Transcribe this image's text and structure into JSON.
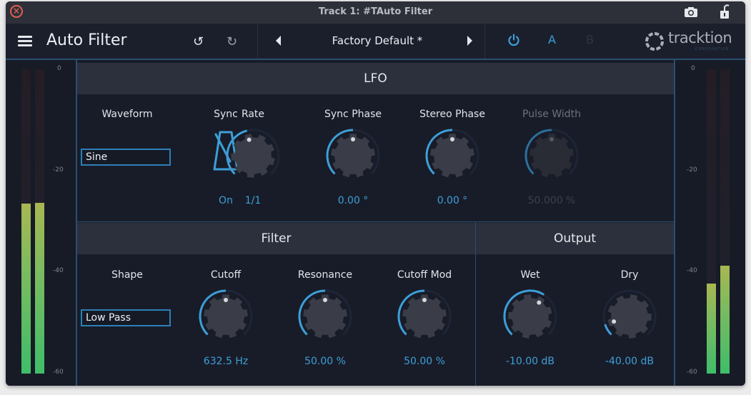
{
  "window": {
    "title": "Track 1: #TAuto Filter",
    "close_icon": "close-icon",
    "camera_icon": "camera-icon",
    "lock_icon": "unlocked-padlock-icon"
  },
  "header": {
    "menu_icon": "hamburger-icon",
    "plugin_name": "Auto Filter",
    "undo_glyph": "↺",
    "redo_glyph": "↻",
    "preset_name": "Factory Default *",
    "power_icon": "power-icon",
    "ab_a": "A",
    "ab_b": "B",
    "logo_text": "tracktion",
    "logo_sub": "CORPORATION"
  },
  "colors": {
    "accent": "#3d9fd8",
    "panel_bg": "#181c28",
    "section_header": "#2c303c",
    "knob_body": "#3a3d47",
    "border": "#2a4f70"
  },
  "meters": {
    "scale_labels": [
      "0",
      "-20",
      "-40",
      "-60"
    ],
    "scale_range_db": [
      0,
      -60
    ],
    "input": {
      "left_db": -26.5,
      "right_db": -26.4
    },
    "output": {
      "left_db": -42.3,
      "right_db": -38.8
    }
  },
  "lfo": {
    "title": "LFO",
    "waveform": {
      "label": "Waveform",
      "value": "Sine"
    },
    "sync": {
      "label": "Sync",
      "value": "On",
      "icon": "metronome-icon"
    },
    "knobs": [
      {
        "label": "Rate",
        "value": "1/1",
        "position": 0.45,
        "enabled": true
      },
      {
        "label": "Sync Phase",
        "value": "0.00 °",
        "position": 0.5,
        "enabled": true
      },
      {
        "label": "Stereo Phase",
        "value": "0.00 °",
        "position": 0.5,
        "enabled": true
      },
      {
        "label": "Pulse Width",
        "value": "50.000 %",
        "position": 0.5,
        "enabled": false
      }
    ]
  },
  "filter": {
    "title": "Filter",
    "shape": {
      "label": "Shape",
      "value": "Low Pass"
    },
    "knobs": [
      {
        "label": "Cutoff",
        "value": "632.5 Hz",
        "position": 0.5,
        "enabled": true
      },
      {
        "label": "Resonance",
        "value": "50.00 %",
        "position": 0.5,
        "enabled": true
      },
      {
        "label": "Cutoff Mod",
        "value": "50.00 %",
        "position": 0.5,
        "enabled": true
      }
    ]
  },
  "output": {
    "title": "Output",
    "knobs": [
      {
        "label": "Wet",
        "value": "-10.00 dB",
        "position": 0.62,
        "enabled": true
      },
      {
        "label": "Dry",
        "value": "-40.00 dB",
        "position": 0.1,
        "enabled": true
      }
    ]
  }
}
